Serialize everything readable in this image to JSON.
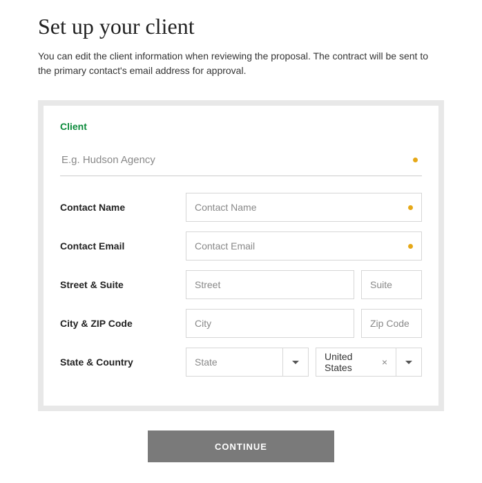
{
  "header": {
    "title": "Set up your client",
    "subtitle": "You can edit the client information when reviewing the proposal. The contract will be sent to the primary contact's email address for approval."
  },
  "section": {
    "label": "Client",
    "client_placeholder": "E.g. Hudson Agency"
  },
  "rows": {
    "contact_name": {
      "label": "Contact Name",
      "placeholder": "Contact Name"
    },
    "contact_email": {
      "label": "Contact Email",
      "placeholder": "Contact Email"
    },
    "street_suite": {
      "label": "Street & Suite",
      "street_ph": "Street",
      "suite_ph": "Suite"
    },
    "city_zip": {
      "label": "City & ZIP Code",
      "city_ph": "City",
      "zip_ph": "Zip Code"
    },
    "state_country": {
      "label": "State & Country",
      "state_ph": "State",
      "country_value": "United States"
    }
  },
  "actions": {
    "continue": "CONTINUE"
  }
}
